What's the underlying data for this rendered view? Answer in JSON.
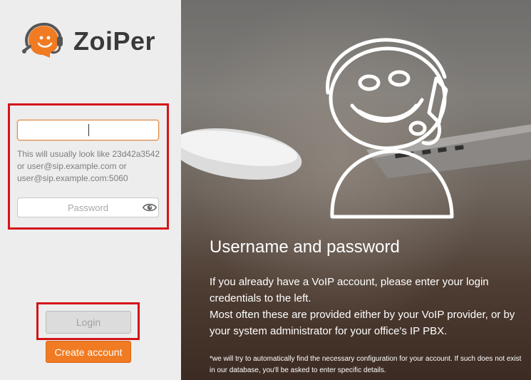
{
  "brand": {
    "name": "ZoiPer",
    "accent_color": "#f07b22",
    "highlight_color": "#d3141a"
  },
  "login_form": {
    "username_value": "",
    "username_hint": "This will usually look like 23d42a3542 or user@sip.example.com or user@sip.example.com:5060",
    "password_placeholder": "Password",
    "password_value": "",
    "login_label": "Login",
    "create_account_label": "Create account"
  },
  "info": {
    "title": "Username and password",
    "line1": " If you already have a VoIP account, please enter your login credentials to the left.",
    "line2": "Most often these are provided either by your VoIP provider, or by your system administrator for your office's IP PBX.",
    "note": "*we will try to automatically find the necessary configuration for your account. If such does not exist in our database, you'll be asked to enter specific details."
  },
  "icons": {
    "logo": "headset-logo-icon",
    "show_password": "eye-icon",
    "mascot": "headset-mascot-illustration"
  }
}
